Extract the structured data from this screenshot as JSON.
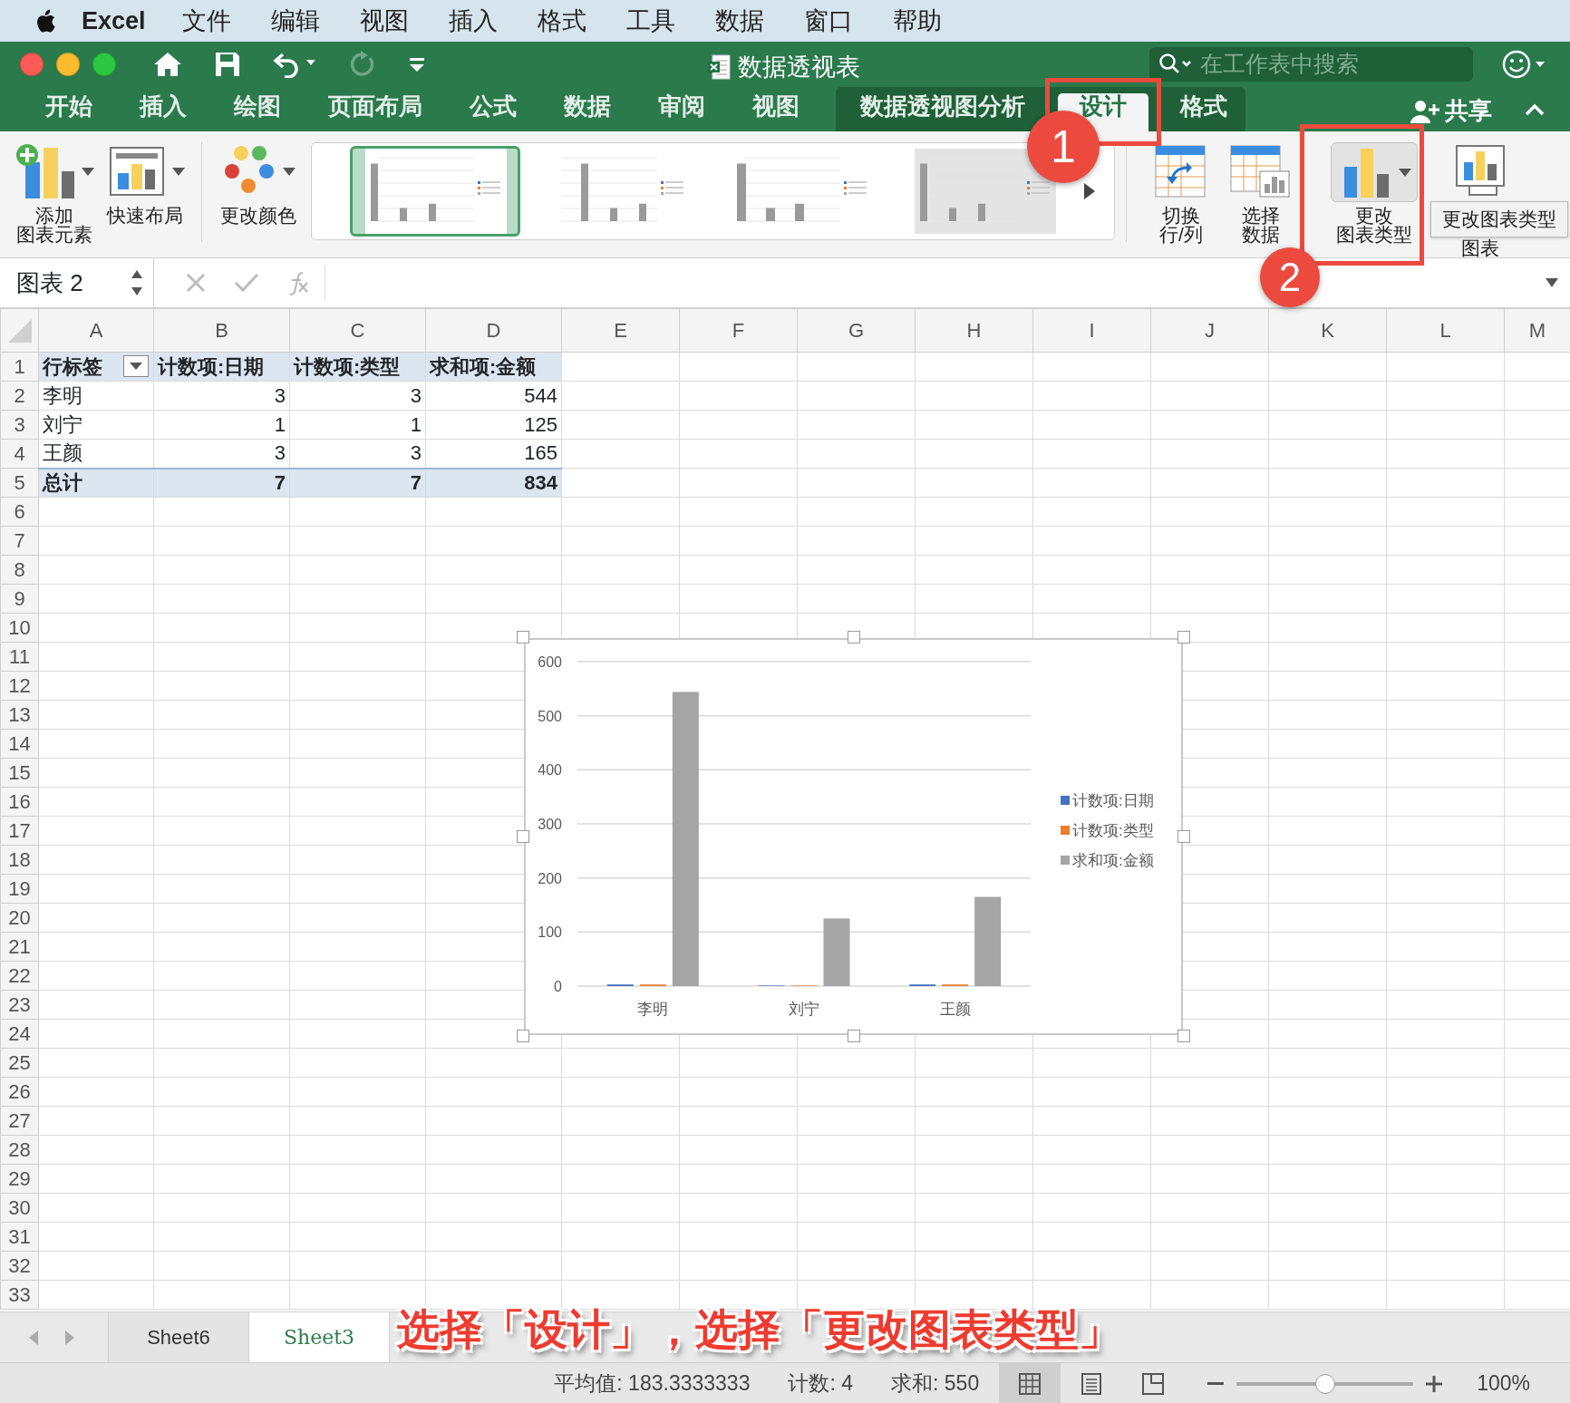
{
  "menu_bar": {
    "app": "Excel",
    "items": [
      "文件",
      "编辑",
      "视图",
      "插入",
      "格式",
      "工具",
      "数据",
      "窗口",
      "帮助"
    ]
  },
  "title_bar": {
    "title": "数据透视表",
    "search": {
      "placeholder": "在工作表中搜索"
    }
  },
  "ribbon_tabs": [
    {
      "label": "开始",
      "selected": false,
      "kind": "normal"
    },
    {
      "label": "插入",
      "selected": false,
      "kind": "normal"
    },
    {
      "label": "绘图",
      "selected": false,
      "kind": "normal"
    },
    {
      "label": "页面布局",
      "selected": false,
      "kind": "normal"
    },
    {
      "label": "公式",
      "selected": false,
      "kind": "normal"
    },
    {
      "label": "数据",
      "selected": false,
      "kind": "normal"
    },
    {
      "label": "审阅",
      "selected": false,
      "kind": "normal"
    },
    {
      "label": "视图",
      "selected": false,
      "kind": "normal"
    },
    {
      "label": "数据透视图分析",
      "selected": false,
      "kind": "context"
    },
    {
      "label": "设计",
      "selected": true,
      "kind": "context"
    },
    {
      "label": "格式",
      "selected": false,
      "kind": "context"
    }
  ],
  "share": "共享",
  "ribbon": {
    "left_buttons": [
      {
        "kind": "add-element",
        "lines": [
          "添加",
          "图表元素"
        ],
        "dropdown": true
      },
      {
        "kind": "layout",
        "lines": [
          "快速布局"
        ],
        "dropdown": true
      },
      {
        "kind": "colors",
        "lines": [
          "更改颜色"
        ],
        "dropdown": true
      }
    ],
    "chart_styles": [
      {
        "selected": true
      },
      {
        "selected": false
      },
      {
        "selected": false
      },
      {
        "selected": false
      }
    ],
    "right_buttons": [
      {
        "kind": "switch",
        "lines": [
          "切换",
          "行/列"
        ],
        "dropdown": false
      },
      {
        "kind": "select-data",
        "lines": [
          "选择",
          "数据"
        ],
        "dropdown": false
      },
      {
        "kind": "change-type",
        "lines": [
          "更改",
          "图表类型"
        ],
        "dropdown": true
      },
      {
        "kind": "move",
        "lines": [
          "图表"
        ],
        "dropdown": false
      }
    ],
    "tooltip": "更改图表类型"
  },
  "callouts": [
    {
      "number": "1"
    },
    {
      "number": "2"
    }
  ],
  "formula_bar": {
    "name_box": "图表 2"
  },
  "columns": [
    "A",
    "B",
    "C",
    "D",
    "E",
    "F",
    "G",
    "H",
    "I",
    "J",
    "K",
    "L",
    "M"
  ],
  "row_count_labels": [
    "1",
    "2",
    "3",
    "4",
    "5",
    "6",
    "7",
    "8",
    "9",
    "10",
    "11",
    "12",
    "13",
    "14",
    "15",
    "16",
    "17",
    "18",
    "19",
    "20",
    "21",
    "22",
    "23",
    "24",
    "25",
    "26",
    "27",
    "28",
    "29",
    "30",
    "31",
    "32",
    "33"
  ],
  "pivot": {
    "header": [
      "行标签",
      "计数项:日期",
      "计数项:类型",
      "求和项:金额"
    ],
    "rows": [
      [
        "李明",
        "3",
        "3",
        "544"
      ],
      [
        "刘宁",
        "1",
        "1",
        "125"
      ],
      [
        "王颜",
        "3",
        "3",
        "165"
      ]
    ],
    "total": [
      "总计",
      "7",
      "7",
      "834"
    ]
  },
  "chart": {
    "chart_data": {
      "type": "bar",
      "categories": [
        "李明",
        "刘宁",
        "王颜"
      ],
      "series": [
        {
          "name": "计数项:日期",
          "color": "#4472c4",
          "values": [
            3,
            1,
            3
          ]
        },
        {
          "name": "计数项:类型",
          "color": "#ed7d31",
          "values": [
            3,
            1,
            3
          ]
        },
        {
          "name": "求和项:金额",
          "color": "#a5a5a5",
          "values": [
            544,
            125,
            165
          ]
        }
      ],
      "ylim": [
        0,
        600
      ],
      "yticks": [
        0,
        100,
        200,
        300,
        400,
        500,
        600
      ],
      "grid": true,
      "legend": true
    }
  },
  "sheet_tabs": [
    {
      "label": "Sheet6",
      "selected": false
    },
    {
      "label": "Sheet3",
      "selected": true
    }
  ],
  "caption": "选择「设计」，选择「更改图表类型」",
  "status_bar": {
    "average": "平均值: 183.3333333",
    "count": "计数: 4",
    "sum": "求和: 550",
    "views": [
      {
        "kind": "normal",
        "selected": true
      },
      {
        "kind": "page-layout",
        "selected": false
      },
      {
        "kind": "page-break",
        "selected": false
      }
    ],
    "zoom_slider": {
      "level": 0.5
    },
    "zoom": "100%"
  }
}
